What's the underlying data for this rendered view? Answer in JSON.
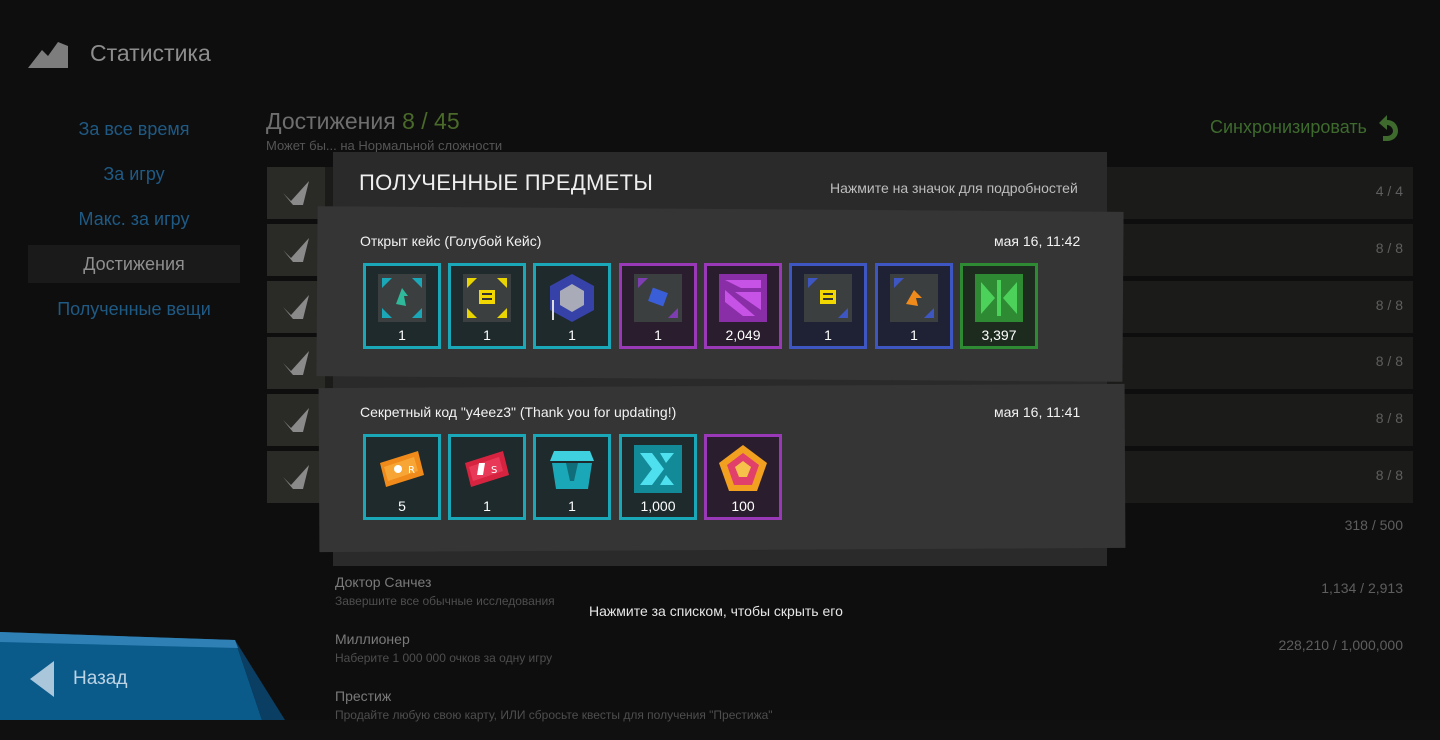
{
  "header": {
    "title": "Статистика",
    "icon": "mountain-icon"
  },
  "sidebar": {
    "items": [
      {
        "label": "За все время"
      },
      {
        "label": "За игру"
      },
      {
        "label": "Макс. за игру"
      },
      {
        "label": "Достижения",
        "active": true
      },
      {
        "label": "Полученные вещи"
      }
    ]
  },
  "achievements": {
    "title": "Достижения",
    "count": "8 / 45",
    "subtitle": "Может бы... на Нормальной сложности",
    "sync_label": "Синхронизировать",
    "rows": [
      {
        "value": "4 / 4"
      },
      {
        "value": "8 / 8"
      },
      {
        "value": "8 / 8"
      },
      {
        "value": "8 / 8"
      },
      {
        "value": "8 / 8"
      },
      {
        "value": "8 / 8"
      },
      {
        "value": "318 / 500"
      }
    ],
    "progress_rows": [
      {
        "name": "Доктор Санчез",
        "desc": "Завершите все обычные исследования",
        "value": "1,134 / 2,913"
      },
      {
        "name": "Миллионер",
        "desc": "Наберите 1 000 000 очков за одну игру",
        "value": "228,210 / 1,000,000"
      },
      {
        "name": "Престиж",
        "desc": "Продайте любую свою карту, ИЛИ сбросьте квесты для получения \"Престижа\"",
        "value": ""
      }
    ]
  },
  "back": {
    "label": "Назад"
  },
  "modal": {
    "title": "ПОЛУЧЕННЫЕ ПРЕДМЕТЫ",
    "hint": "Нажмите на значок для подробностей",
    "footer_hint": "Нажмите за списком, чтобы скрыть его",
    "entries": [
      {
        "title": "Открыт кейс (Голубой Кейс)",
        "date": "мая 16, 11:42",
        "items": [
          {
            "count": "1",
            "rarity": "teal",
            "icon": "green-module-icon"
          },
          {
            "count": "1",
            "rarity": "teal",
            "icon": "yellow-module-icon"
          },
          {
            "count": "1",
            "rarity": "teal",
            "icon": "hexagon-module-icon"
          },
          {
            "count": "1",
            "rarity": "purple",
            "icon": "blue-module-icon"
          },
          {
            "count": "2,049",
            "rarity": "purple",
            "icon": "purple-stripes-icon"
          },
          {
            "count": "1",
            "rarity": "blue",
            "icon": "yellow-module-icon"
          },
          {
            "count": "1",
            "rarity": "blue",
            "icon": "orange-module-icon"
          },
          {
            "count": "3,397",
            "rarity": "green",
            "icon": "green-tokens-icon"
          }
        ]
      },
      {
        "title": "Секретный код \"y4eez3\" (Thank you for updating!)",
        "date": "мая 16, 11:41",
        "items": [
          {
            "count": "5",
            "rarity": "teal",
            "icon": "orange-ticket-icon"
          },
          {
            "count": "1",
            "rarity": "teal",
            "icon": "red-ticket-icon"
          },
          {
            "count": "1",
            "rarity": "teal",
            "icon": "teal-crate-icon"
          },
          {
            "count": "1,000",
            "rarity": "teal",
            "icon": "teal-tokens-icon"
          },
          {
            "count": "100",
            "rarity": "purple",
            "icon": "pentagon-icon"
          }
        ]
      }
    ]
  },
  "colors": {
    "teal": "#1aa8b8",
    "purple": "#9a39b8",
    "blue": "#3e56c2",
    "green": "#2f8a34"
  }
}
